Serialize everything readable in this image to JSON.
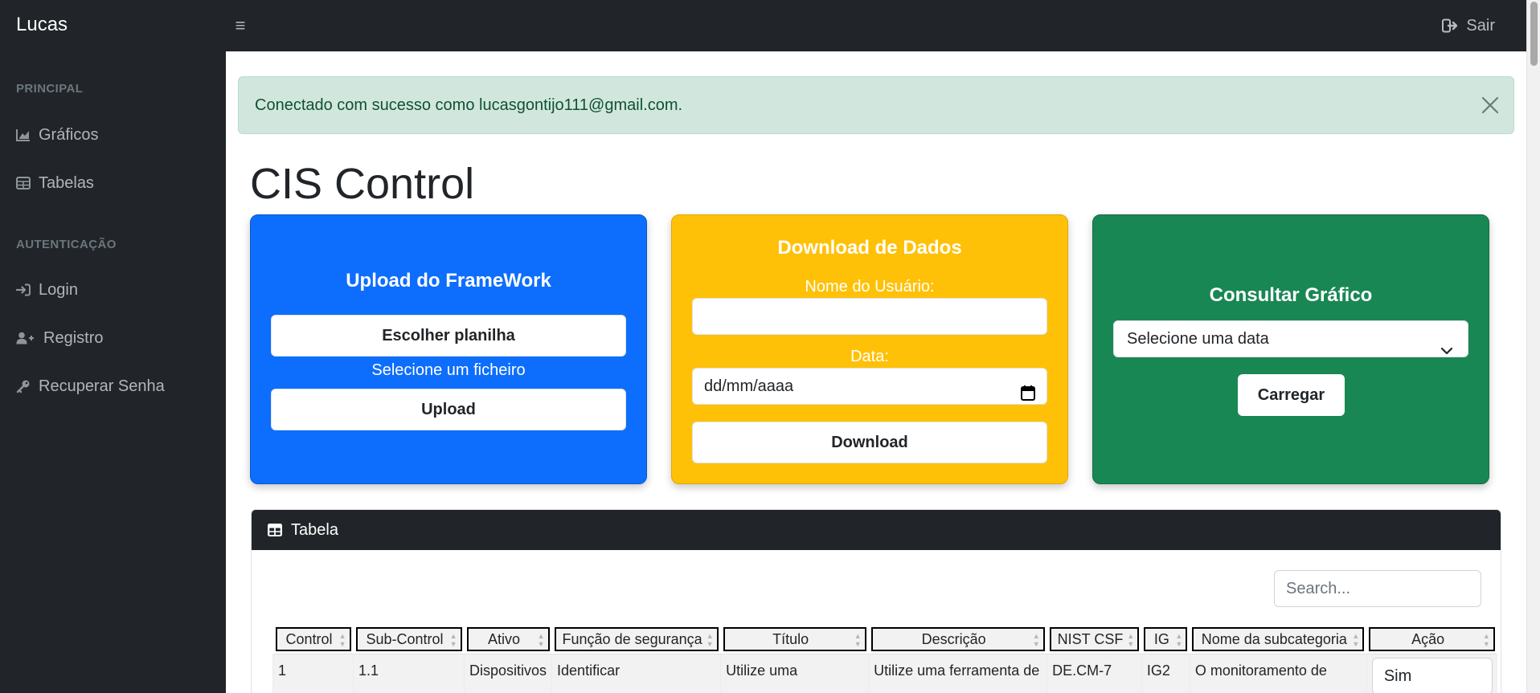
{
  "app": {
    "brand": "Lucas",
    "logout_label": "Sair"
  },
  "sidebar": {
    "sections": [
      {
        "heading": "PRINCIPAL",
        "items": [
          {
            "label": "Gráficos",
            "icon": "chart-area-icon"
          },
          {
            "label": "Tabelas",
            "icon": "table-icon"
          }
        ]
      },
      {
        "heading": "AUTENTICAÇÃO",
        "items": [
          {
            "label": "Login",
            "icon": "sign-in-icon"
          },
          {
            "label": "Registro",
            "icon": "user-plus-icon"
          },
          {
            "label": "Recuperar Senha",
            "icon": "key-icon"
          }
        ]
      }
    ]
  },
  "alert": {
    "message": "Conectado com sucesso como lucasgontijo111@gmail.com."
  },
  "page": {
    "title": "CIS Control"
  },
  "upload_card": {
    "title": "Upload do FrameWork",
    "choose_label": "Escolher planilha",
    "file_status": "Selecione um ficheiro",
    "upload_label": "Upload",
    "color": "#0d6efd"
  },
  "download_card": {
    "title": "Download de Dados",
    "user_label": "Nome do Usuário:",
    "user_value": "",
    "date_label": "Data:",
    "date_placeholder": "dd/mm/aaaa",
    "download_label": "Download",
    "color": "#ffc107"
  },
  "chart_card": {
    "title": "Consultar Gráfico",
    "select_value": "Selecione uma data",
    "load_label": "Carregar",
    "color": "#198754"
  },
  "table": {
    "title": "Tabela",
    "search_placeholder": "Search...",
    "columns": [
      "Control",
      "Sub-Control",
      "Ativo",
      "Função de segurança",
      "Título",
      "Descrição",
      "NIST CSF",
      "IG",
      "Nome da subcategoria",
      "Ação"
    ],
    "rows": [
      [
        "1",
        "1.1",
        "Dispositivos",
        "Identificar",
        "Utilize uma",
        "Utilize uma ferramenta de",
        "DE.CM-7",
        "IG2",
        "O monitoramento de",
        "Sim"
      ]
    ]
  }
}
